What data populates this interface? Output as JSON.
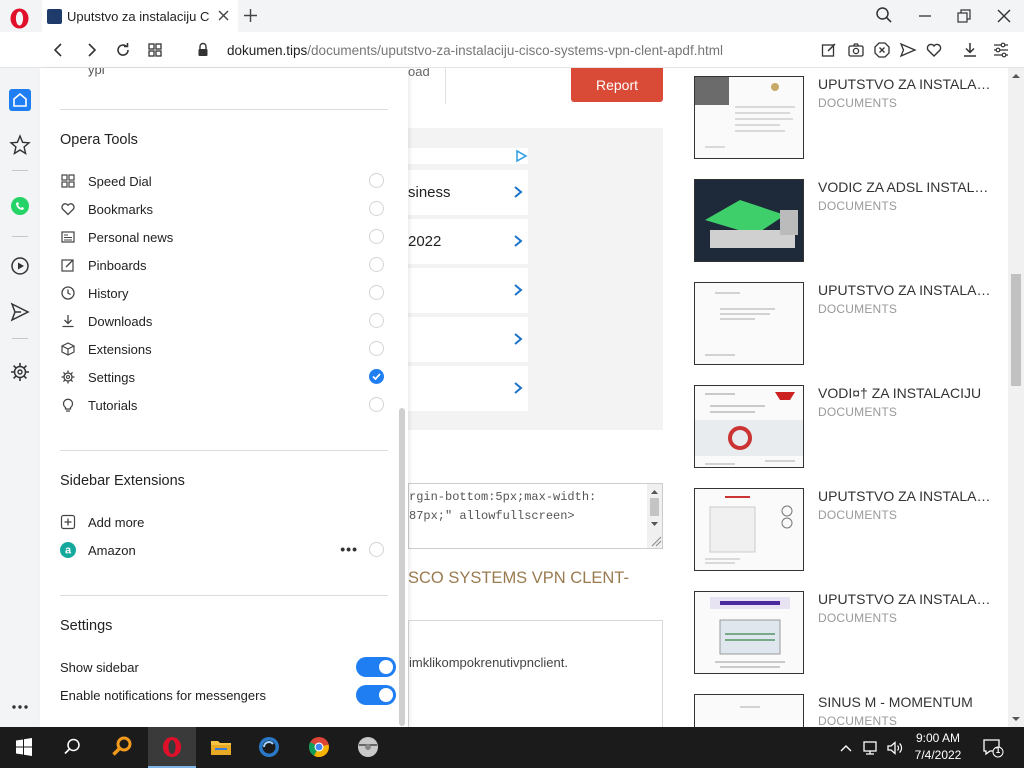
{
  "browser": {
    "tab_title": "Uputstvo za instalaciju Cisco Systems VPN Clent",
    "url_domain": "dokumen.tips",
    "url_path": "/documents/uputstvo-za-instalaciju-cisco-systems-vpn-clent-apdf.html",
    "accent_color": "#1f7ef2"
  },
  "panel": {
    "top_partial_left": "ypi",
    "opera_tools_title": "Opera Tools",
    "tools": [
      {
        "icon": "speed-dial-icon",
        "label": "Speed Dial",
        "checked": false
      },
      {
        "icon": "heart-icon",
        "label": "Bookmarks",
        "checked": false
      },
      {
        "icon": "news-icon",
        "label": "Personal news",
        "checked": false
      },
      {
        "icon": "pinboard-icon",
        "label": "Pinboards",
        "checked": false
      },
      {
        "icon": "clock-icon",
        "label": "History",
        "checked": false
      },
      {
        "icon": "download-icon",
        "label": "Downloads",
        "checked": false
      },
      {
        "icon": "cube-icon",
        "label": "Extensions",
        "checked": false
      },
      {
        "icon": "gear-icon",
        "label": "Settings",
        "checked": true
      },
      {
        "icon": "bulb-icon",
        "label": "Tutorials",
        "checked": false
      }
    ],
    "sidebar_extensions_title": "Sidebar Extensions",
    "add_more": "Add more",
    "amazon": "Amazon",
    "more_dots": "•••",
    "settings_title": "Settings",
    "show_sidebar": "Show sidebar",
    "enable_notifications": "Enable notifications for messengers"
  },
  "page": {
    "top_fragment": "oad",
    "report_button": "Report",
    "ad_rows": [
      "siness",
      "2022"
    ],
    "embed_lines": [
      "rgin-bottom:5px;max-width:",
      "87px;\" allowfullscreen>"
    ],
    "doc_heading_line1": "SCO SYSTEMS VPN CLENT-",
    "text_fragment": "imklikompokrenutivpnclient.",
    "related": [
      {
        "title": "UPUTSTVO ZA INSTALACIJU",
        "category": "DOCUMENTS"
      },
      {
        "title": "VODIC ZA ADSL INSTALACIJU",
        "category": "DOCUMENTS"
      },
      {
        "title": "UPUTSTVO ZA INSTALACIJU",
        "category": "DOCUMENTS"
      },
      {
        "title": "VODI¤† ZA INSTALACIJU",
        "category": "DOCUMENTS"
      },
      {
        "title": "UPUTSTVO ZA INSTALACIJU",
        "category": "DOCUMENTS"
      },
      {
        "title": "UPUTSTVO ZA INSTALACIJU",
        "category": "DOCUMENTS"
      },
      {
        "title": "SINUS M - MOMENTUM",
        "category": "DOCUMENTS"
      }
    ]
  },
  "taskbar": {
    "time": "9:00 AM",
    "date": "7/4/2022",
    "notification_count": "1"
  }
}
